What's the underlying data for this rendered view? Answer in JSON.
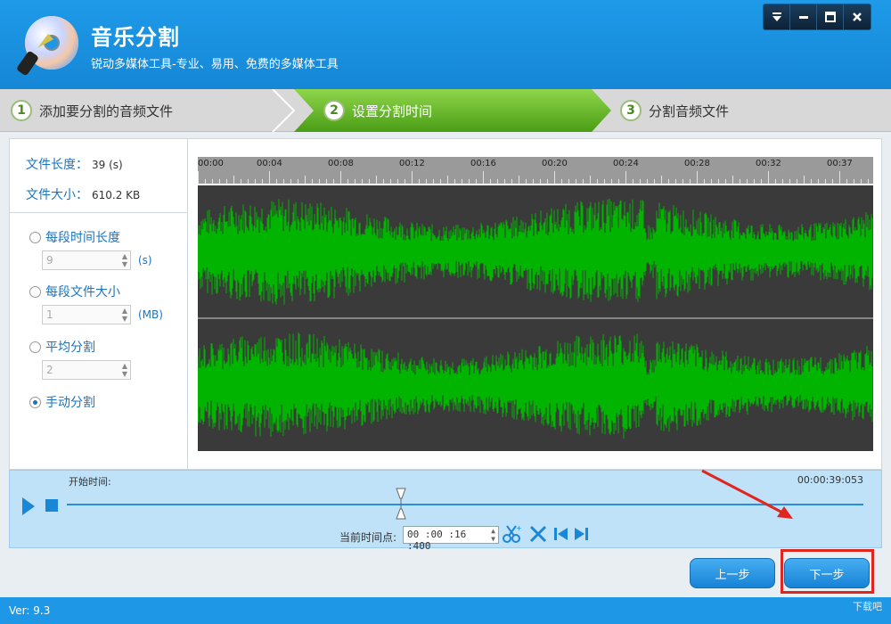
{
  "header": {
    "title": "音乐分割",
    "subtitle": "锐动多媒体工具-专业、易用、免费的多媒体工具"
  },
  "steps": [
    {
      "num": "1",
      "label": "添加要分割的音频文件"
    },
    {
      "num": "2",
      "label": "设置分割时间"
    },
    {
      "num": "3",
      "label": "分割音频文件"
    }
  ],
  "file_info": {
    "length_label": "文件长度：",
    "length_value": "39 (s)",
    "size_label": "文件大小：",
    "size_value": "610.2 KB"
  },
  "options": {
    "per_time": {
      "label": "每段时间长度",
      "value": "9",
      "unit": "(s)"
    },
    "per_size": {
      "label": "每段文件大小",
      "value": "1",
      "unit": "(MB)"
    },
    "average": {
      "label": "平均分割",
      "value": "2"
    },
    "manual": {
      "label": "手动分割",
      "selected": true
    }
  },
  "timeline": {
    "ticks": [
      "00:00",
      "00:04",
      "00:08",
      "00:12",
      "00:16",
      "00:20",
      "00:24",
      "00:28",
      "00:32",
      "00:37"
    ]
  },
  "player": {
    "start_label": "开始时间:",
    "total_time": "00:00:39:053",
    "current_label": "当前时间点:",
    "current_value": "00 :00 :16 :400",
    "position_fraction": 0.42
  },
  "buttons": {
    "prev": "上一步",
    "next": "下一步"
  },
  "footer": {
    "version": "Ver: 9.3",
    "watermark": "下载吧"
  },
  "colors": {
    "accent": "#1e97e6",
    "waveform": "#00b400",
    "step_active": "#5fb320",
    "highlight": "#e0271f"
  }
}
